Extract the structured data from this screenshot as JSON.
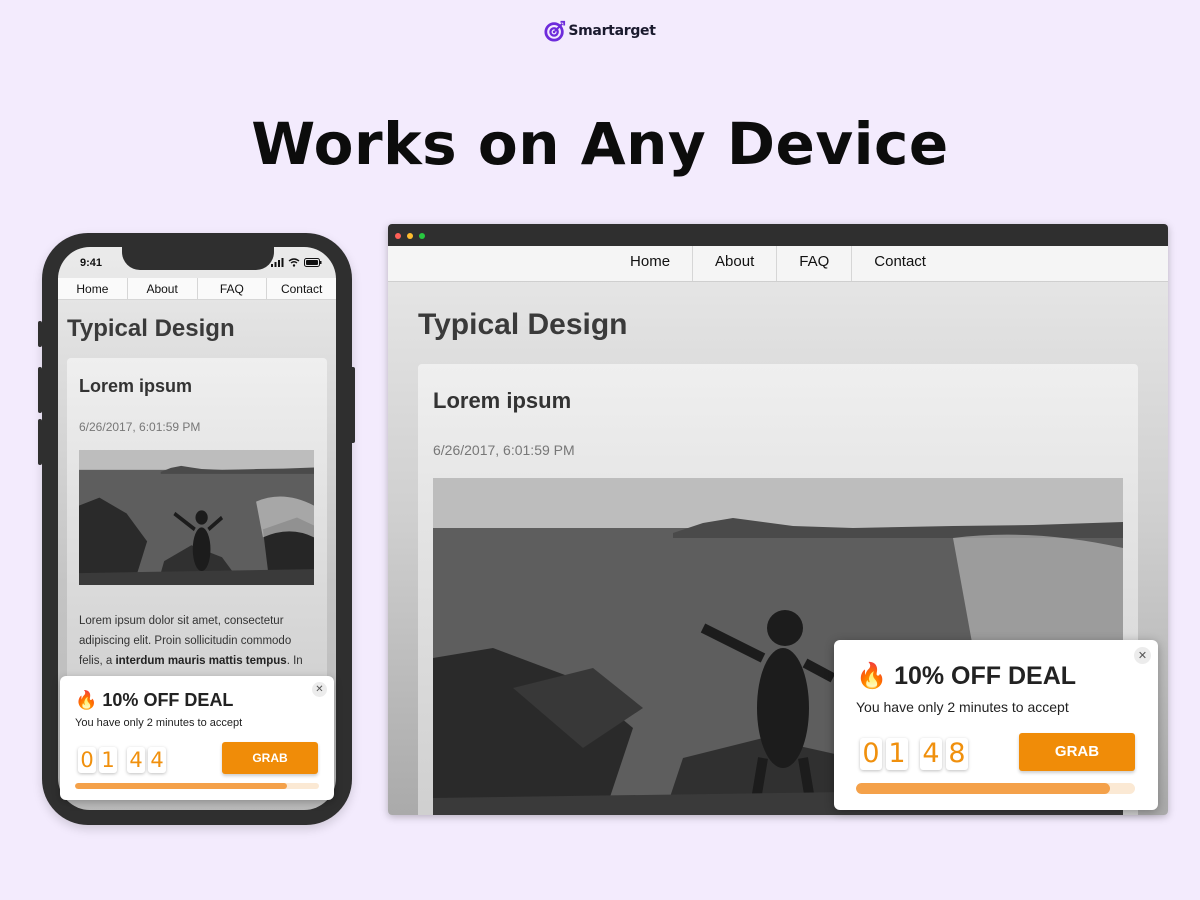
{
  "brand": {
    "name": "Smartarget",
    "color": "#6d2bdb"
  },
  "headline": "Works on Any Device",
  "nav": [
    "Home",
    "About",
    "FAQ",
    "Contact"
  ],
  "phone": {
    "status_time": "9:41",
    "page_title": "Typical Design",
    "card": {
      "title": "Lorem ipsum",
      "date": "6/26/2017, 6:01:59 PM",
      "text_before": "Lorem ipsum dolor sit amet, consectetur adipiscing elit. Proin sollicitudin commodo felis, a ",
      "text_bold": "interdum mauris mattis tempus",
      "text_after": ". In"
    },
    "popup": {
      "icon": "fire-icon",
      "title": "🔥 10% OFF DEAL",
      "subtitle": "You have only 2 minutes to accept",
      "digits": [
        "0",
        "1",
        "4",
        "4"
      ],
      "button": "GRAB",
      "progress": 0.87
    }
  },
  "desktop": {
    "page_title": "Typical Design",
    "card": {
      "title": "Lorem ipsum",
      "date": "6/26/2017, 6:01:59 PM"
    },
    "popup": {
      "icon": "fire-icon",
      "title": "🔥 10% OFF DEAL",
      "subtitle": "You have only 2 minutes to accept",
      "digits": [
        "0",
        "1",
        "4",
        "8"
      ],
      "button": "GRAB",
      "progress": 0.91
    }
  },
  "colors": {
    "background": "#f3ebfd",
    "accent": "#f08c08",
    "progress": "#f4a14a"
  }
}
